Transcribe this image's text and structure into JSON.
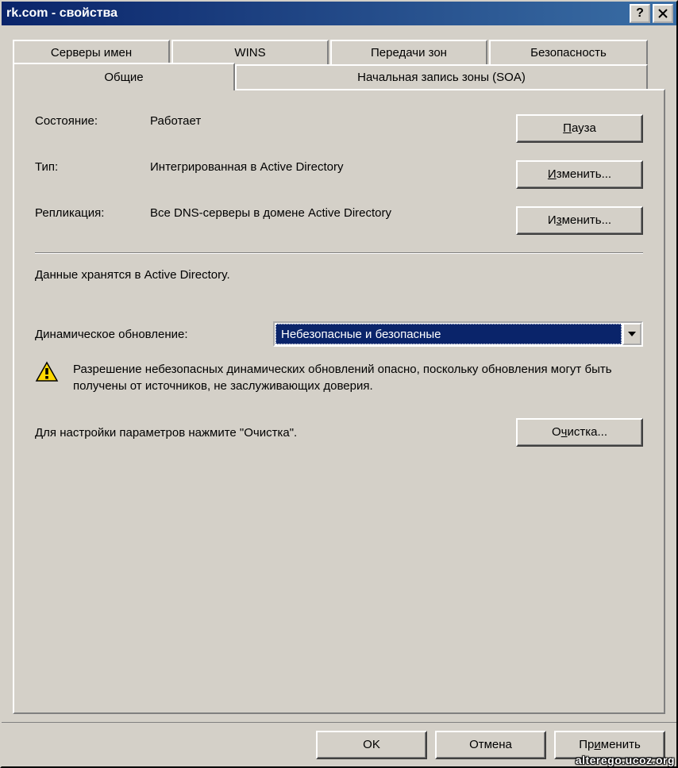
{
  "titlebar": {
    "title": "rk.com - свойства"
  },
  "tabs": {
    "row1": [
      "Серверы имен",
      "WINS",
      "Передачи зон",
      "Безопасность"
    ],
    "row2": {
      "general": "Общие",
      "soa": "Начальная запись зоны (SOA)"
    }
  },
  "general": {
    "state_label": "Состояние:",
    "state_value": "Работает",
    "type_label": "Тип:",
    "type_value": "Интегрированная в Active Directory",
    "repl_label": "Репликация:",
    "repl_value": "Все DNS-серверы в домене Active Directory",
    "storage": "Данные хранятся в Active Directory.",
    "dynupd_label": "Динамическое обновление:",
    "dynupd_value": "Небезопасные и безопасные",
    "warn_text": "Разрешение небезопасных динамических обновлений опасно, поскольку обновления могут быть получены от источников, не заслуживающих доверия.",
    "cleanup_hint": "Для настройки параметров нажмите \"Очистка\"."
  },
  "buttons": {
    "pause": "Пауза",
    "change": "Изменить...",
    "cleanup": "Очистка...",
    "ok": "OK",
    "cancel": "Отмена",
    "apply": "Применить"
  },
  "watermark": "alterego.ucoz.org"
}
